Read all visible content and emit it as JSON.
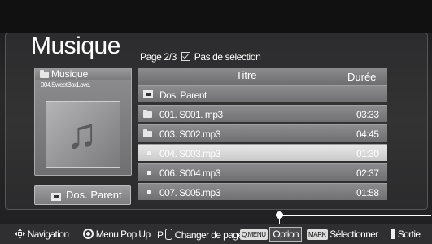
{
  "header": {
    "title": "Musique",
    "page_indicator": "Page 2/3",
    "selection_status": "Pas de sélection"
  },
  "album_panel": {
    "folder_label": "Musique",
    "current_file": "004.SweetBoxLove.",
    "art_icon": "music-note-icon",
    "parent_button_label": "Dos. Parent"
  },
  "file_list": {
    "columns": [
      "Titre",
      "Durée"
    ],
    "rows": [
      {
        "type": "parent",
        "name": "Dos. Parent",
        "duration": ""
      },
      {
        "type": "folder",
        "name": "001. S001. mp3",
        "duration": "03:33"
      },
      {
        "type": "folder",
        "name": "003. S002.mp3",
        "duration": "04:45"
      },
      {
        "type": "file",
        "name": "004. S003.mp3",
        "duration": "01:30",
        "selected": true
      },
      {
        "type": "file",
        "name": "006. S004.mp3",
        "duration": "02:37"
      },
      {
        "type": "file",
        "name": "007. S005.mp3",
        "duration": "01:58"
      }
    ]
  },
  "footer": {
    "navigation": "Navigation",
    "menu_popup": "Menu Pop Up",
    "page_key": "P",
    "change_page": "Changer de page",
    "qmenu_key": "Q.MENU",
    "option": "Option",
    "mark_key": "MARK",
    "select": "Sélectionner",
    "exit": "Sortie"
  },
  "colors": {
    "selected_row": "#d8d8d8",
    "row": "#7e7e81",
    "background": "#1c1c1e"
  }
}
